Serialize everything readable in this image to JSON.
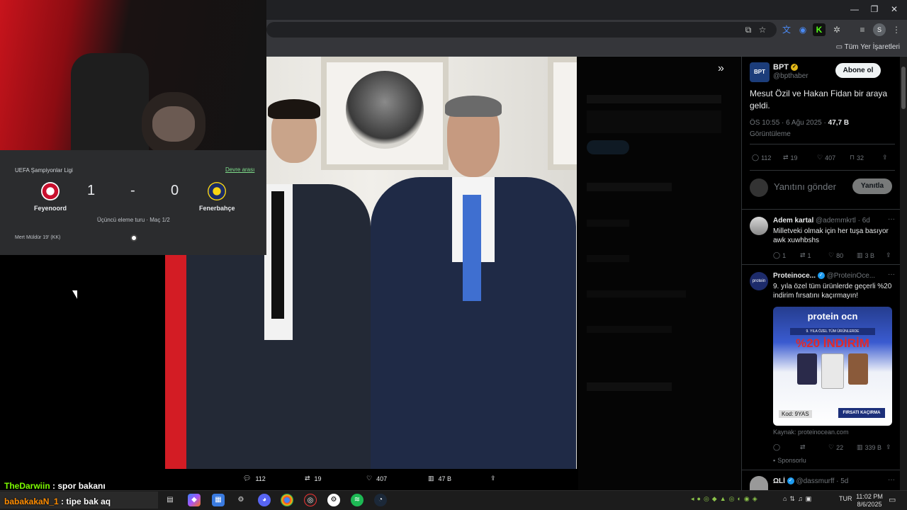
{
  "browser": {
    "bookmarks_label": "Tüm Yer İşaretleri",
    "profile_initial": "S"
  },
  "widget": {
    "competition": "UEFA Şampiyonlar Ligi",
    "status": "Devre arası",
    "home_team": "Feyenoord",
    "away_team": "Fenerbahçe",
    "home_score": "1",
    "separator": "-",
    "away_score": "0",
    "round": "Üçüncü eleme turu · Maç 1/2",
    "event": "Mert Müldür 19' (KK)"
  },
  "photo_bar": {
    "replies": "112",
    "retweets": "19",
    "likes": "407",
    "views": "47 B"
  },
  "tweet": {
    "author": "BPT",
    "handle": "@bpthaber",
    "follow_label": "Abone ol",
    "text": "Mesut Özil ve Hakan Fidan bir araya geldi.",
    "timestamp": "ÖS 10:55 · 6 Ağu 2025 · ",
    "views_count": "47,7 B",
    "views_label": "Görüntüleme",
    "replies": "112",
    "retweets": "19",
    "likes": "407",
    "bookmarks": "32",
    "reply_placeholder": "Yanıtını gönder",
    "reply_button": "Yanıtla"
  },
  "replies": [
    {
      "author": "Adem kartal",
      "handle": "@ademmkrtl · 6d",
      "text": "Milletveki olmak için her tuşa basıyor awk xuwhbshs",
      "replies": "1",
      "retweets": "1",
      "likes": "80",
      "views": "3 B"
    },
    {
      "author": "Proteinoce...",
      "handle": "@ProteinOce...",
      "text": "9. yıla özel tüm ürünlerde geçerli %20 indirim fırsatını kaçırmayın!",
      "ad_brand": "protein ocn",
      "ad_banner": "9. YILA ÖZEL TÜM ÜRÜNLERDE",
      "ad_headline": "%20 İNDİRİM",
      "ad_code": "Kod: 9YAS",
      "ad_cta": "FIRSATI KAÇIRMA",
      "source": "Kaynak: proteinocean.com",
      "likes": "22",
      "views": "339 B",
      "sponsored": "Sponsorlu"
    },
    {
      "author": "ΩLİ",
      "handle": "@dassmurff · 5d"
    }
  ],
  "chat": [
    {
      "user": "TheDarwiin",
      "message": "spor bakanı",
      "color": "#7cfc00"
    },
    {
      "user": "babakakaN_1",
      "message": "tipe bak aq",
      "color": "#ff8c00"
    }
  ],
  "taskbar": {
    "time": "11:02 PM",
    "date": "8/6/2025",
    "lang": "TUR"
  }
}
